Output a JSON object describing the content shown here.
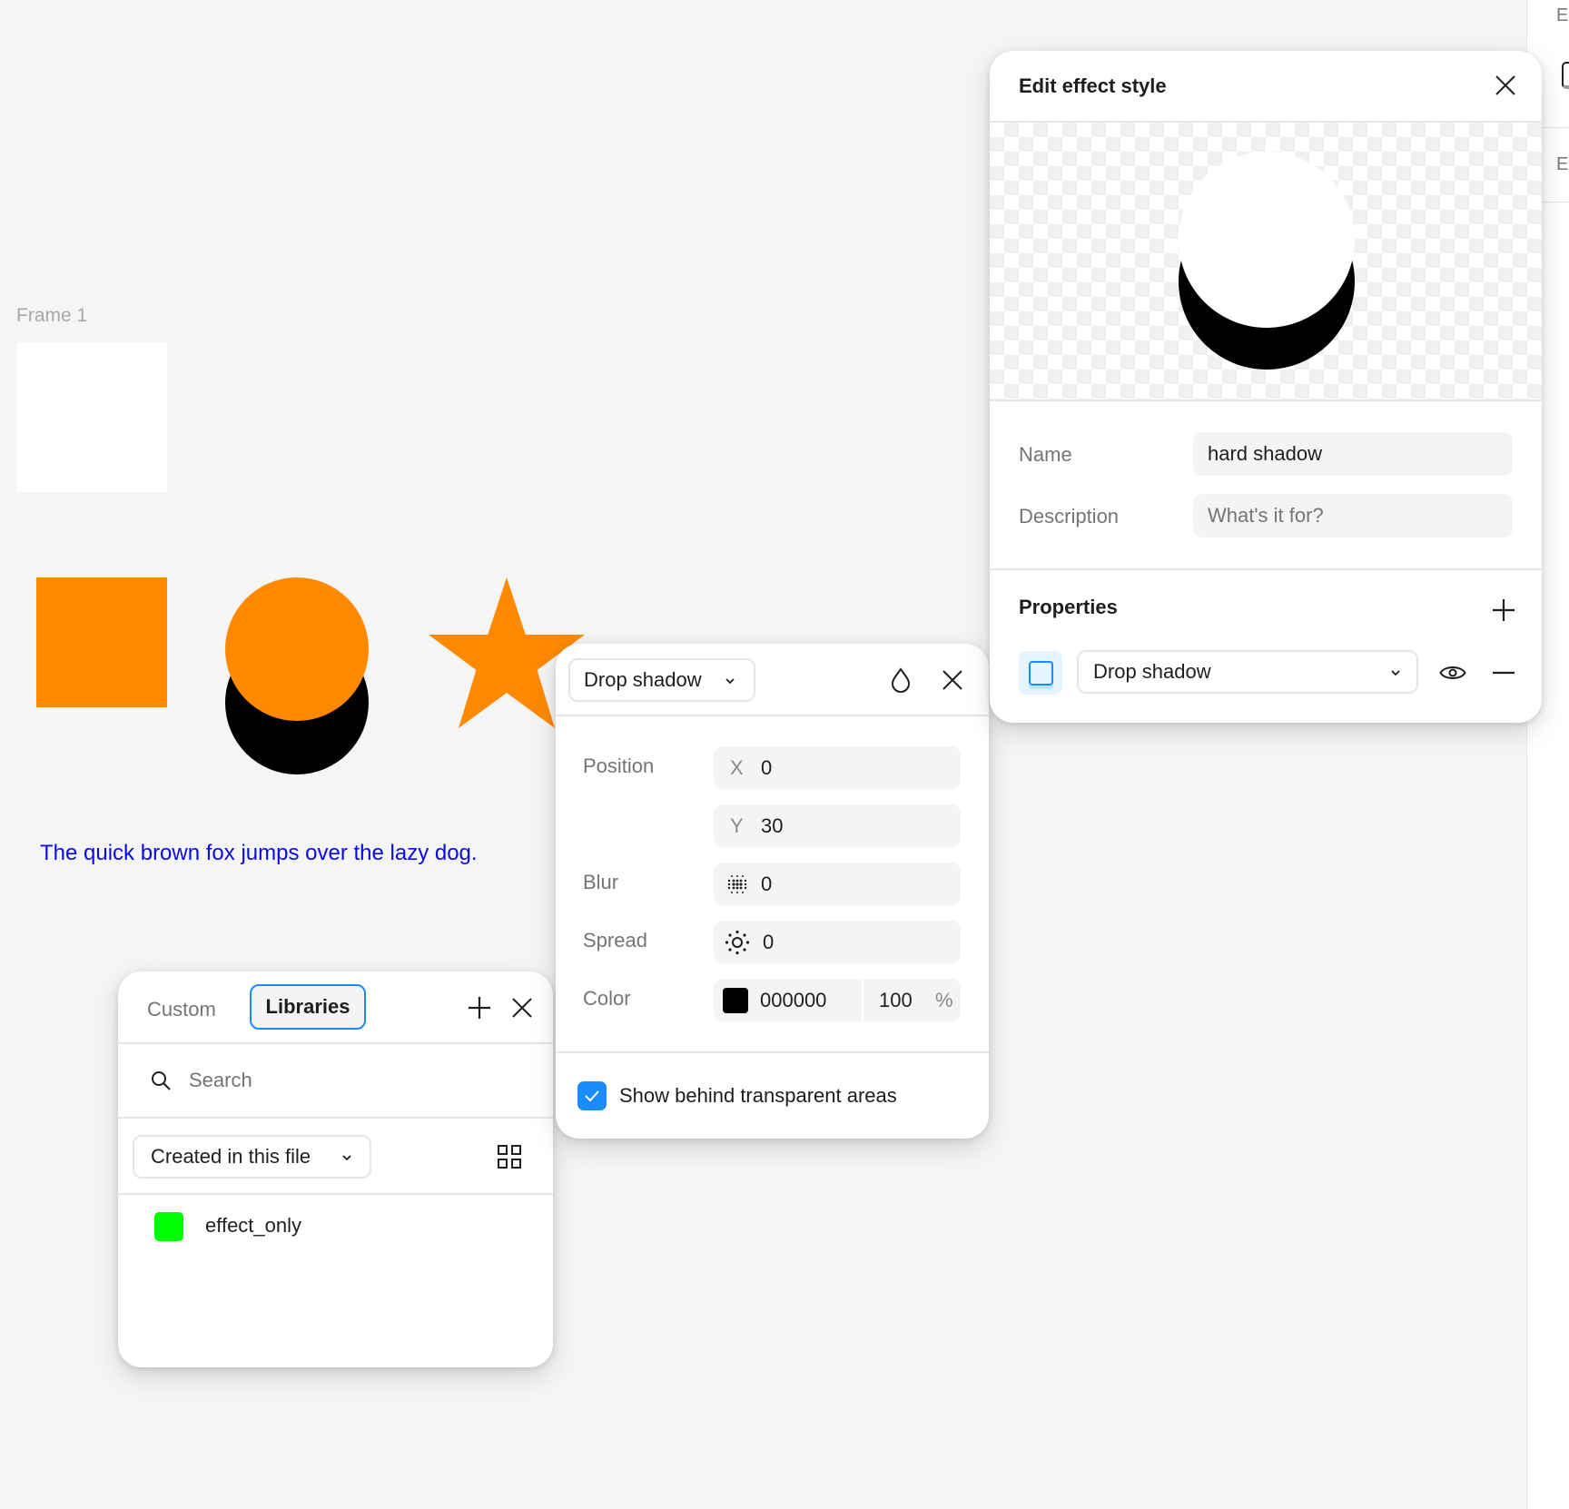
{
  "colors": {
    "canvas_bg": "#f5f5f5",
    "shape_orange": "#ff8a00",
    "shadow_black": "#000000",
    "text_blue": "#0a0ae6",
    "accent_blue": "#1a8cff",
    "library_swatch": "#00ff00"
  },
  "sidebar": {
    "cut_label_1": "E",
    "cut_label_2": "E"
  },
  "canvas": {
    "frame_label": "Frame 1",
    "sample_text": "The quick brown fox jumps over the lazy dog."
  },
  "edit_effect_style": {
    "title": "Edit effect style",
    "close_icon": "close-icon",
    "name_label": "Name",
    "name_value": "hard shadow",
    "description_label": "Description",
    "description_placeholder": "What's it for?",
    "description_value": "",
    "properties_label": "Properties",
    "add_icon": "plus-icon",
    "effect_row": {
      "type": "Drop shadow",
      "visibility_icon": "eye-icon",
      "remove_icon": "minus-icon"
    }
  },
  "drop_shadow_popover": {
    "type": "Drop shadow",
    "blend_icon": "droplet-icon",
    "close_icon": "close-icon",
    "position_label": "Position",
    "x_label": "X",
    "x_value": "0",
    "y_label": "Y",
    "y_value": "30",
    "blur_label": "Blur",
    "blur_value": "0",
    "spread_label": "Spread",
    "spread_value": "0",
    "color_label": "Color",
    "color_hex": "000000",
    "color_swatch": "#000000",
    "opacity_value": "100",
    "opacity_unit": "%",
    "show_behind_label": "Show behind transparent areas",
    "show_behind_checked": true
  },
  "libraries_panel": {
    "tabs": [
      {
        "label": "Custom",
        "active": false
      },
      {
        "label": "Libraries",
        "active": true
      }
    ],
    "search_placeholder": "Search",
    "search_value": "",
    "filter_value": "Created in this file",
    "view_icon": "grid-icon",
    "items": [
      {
        "name": "effect_only",
        "swatch": "#00ff00"
      }
    ]
  }
}
